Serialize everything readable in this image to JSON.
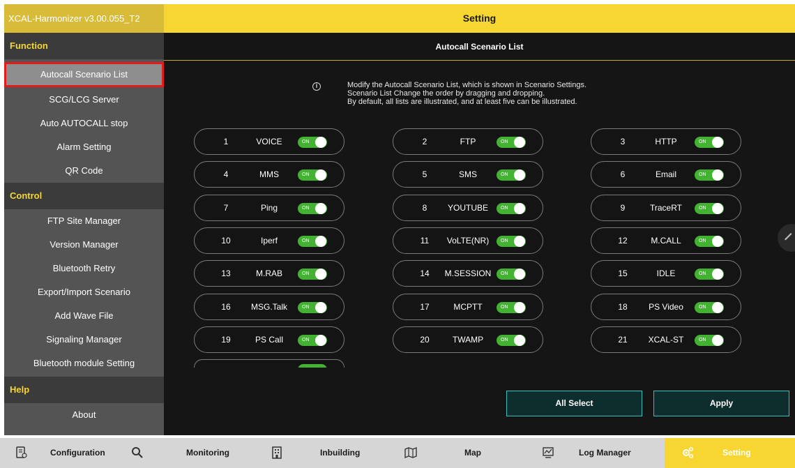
{
  "header": {
    "app_version": "XCAL-Harmonizer v3.00.055_T2",
    "title": "Setting"
  },
  "sidebar": {
    "sections": [
      {
        "title": "Function",
        "items": [
          "Autocall Scenario List",
          "SCG/LCG Server",
          "Auto AUTOCALL stop",
          "Alarm Setting",
          "QR Code"
        ]
      },
      {
        "title": "Control",
        "items": [
          "FTP Site Manager",
          "Version Manager",
          "Bluetooth Retry",
          "Export/Import Scenario",
          "Add Wave File",
          "Signaling Manager",
          "Bluetooth module Setting"
        ]
      },
      {
        "title": "Help",
        "items": [
          "About"
        ]
      }
    ],
    "selected": "Autocall Scenario List"
  },
  "main": {
    "title": "Autocall Scenario List",
    "info_lines": [
      "Modify the Autocall Scenario List, which is shown in Scenario Settings.",
      "Scenario List Change the order by dragging and dropping.",
      "By default, all lists are illustrated, and at least five can be illustrated."
    ],
    "toggle_label": "ON",
    "scenarios": [
      {
        "num": "1",
        "name": "VOICE"
      },
      {
        "num": "2",
        "name": "FTP"
      },
      {
        "num": "3",
        "name": "HTTP"
      },
      {
        "num": "4",
        "name": "MMS"
      },
      {
        "num": "5",
        "name": "SMS"
      },
      {
        "num": "6",
        "name": "Email"
      },
      {
        "num": "7",
        "name": "Ping"
      },
      {
        "num": "8",
        "name": "YOUTUBE"
      },
      {
        "num": "9",
        "name": "TraceRT"
      },
      {
        "num": "10",
        "name": "Iperf"
      },
      {
        "num": "11",
        "name": "VoLTE(NR)"
      },
      {
        "num": "12",
        "name": "M.CALL"
      },
      {
        "num": "13",
        "name": "M.RAB"
      },
      {
        "num": "14",
        "name": "M.SESSION"
      },
      {
        "num": "15",
        "name": "IDLE"
      },
      {
        "num": "16",
        "name": "MSG.Talk"
      },
      {
        "num": "17",
        "name": "MCPTT"
      },
      {
        "num": "18",
        "name": "PS Video"
      },
      {
        "num": "19",
        "name": "PS Call"
      },
      {
        "num": "20",
        "name": "TWAMP"
      },
      {
        "num": "21",
        "name": "XCAL-ST"
      }
    ],
    "all_select_label": "All Select",
    "apply_label": "Apply"
  },
  "bottom_nav": [
    {
      "label": "Configuration",
      "icon": "configuration-icon"
    },
    {
      "label": "Monitoring",
      "icon": "search-icon"
    },
    {
      "label": "Inbuilding",
      "icon": "building-icon"
    },
    {
      "label": "Map",
      "icon": "map-icon"
    },
    {
      "label": "Log Manager",
      "icon": "log-manager-icon"
    },
    {
      "label": "Setting",
      "icon": "settings-gear-icon"
    }
  ],
  "colors": {
    "accent_yellow": "#f7d631",
    "toggle_green": "#43b232",
    "button_border": "#38bfc0",
    "selection_outline": "#e41b1b"
  }
}
